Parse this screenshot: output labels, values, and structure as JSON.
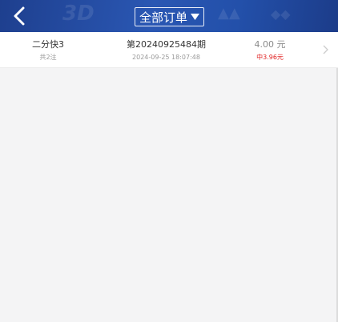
{
  "header": {
    "title": "全部订单",
    "back_icon": "chevron-left-icon",
    "dropdown_icon": "caret-down-icon",
    "background_color": "#2350aa"
  },
  "orders": [
    {
      "game": "二分快3",
      "bets": "共2注",
      "issue": "第20240925484期",
      "time": "2024-09-25 18:07:48",
      "amount": "4.00 元",
      "result": "中3.96元",
      "result_color": "#e02020"
    }
  ]
}
